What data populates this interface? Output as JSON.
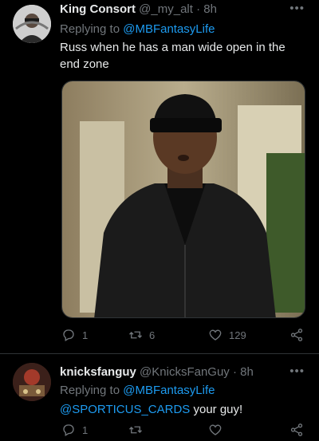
{
  "tweets": [
    {
      "display_name": "King Consort",
      "handle": "@_my_alt",
      "time": "8h",
      "replying_label": "Replying to",
      "replying_to": "@MBFantasyLife",
      "text": "Russ when he has a man wide open in the end zone",
      "reply_count": "1",
      "retweet_count": "6",
      "like_count": "129"
    },
    {
      "display_name": "knicksfanguy",
      "handle": "@KnicksFanGuy",
      "time": "8h",
      "replying_label": "Replying to",
      "replying_to": "@MBFantasyLife",
      "text_mention": "@SPORTICUS_CARDS",
      "text_rest": " your guy!",
      "reply_count": "1"
    }
  ],
  "icons": {
    "more": "more-dots-icon",
    "reply": "reply-icon",
    "retweet": "retweet-icon",
    "like": "heart-icon",
    "share": "share-icon"
  },
  "colors": {
    "background": "#000000",
    "text": "#e7e9ea",
    "secondary": "#71767b",
    "link": "#1d9bf0",
    "divider": "#2f3336"
  }
}
